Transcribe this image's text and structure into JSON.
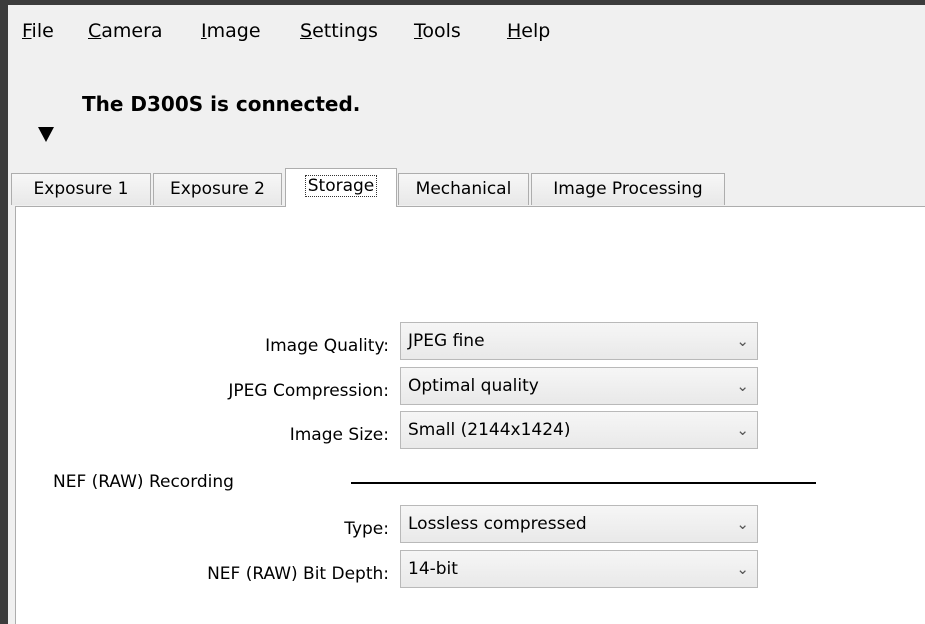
{
  "menu": {
    "file": {
      "mnemonic": "F",
      "rest": "ile"
    },
    "camera": {
      "mnemonic": "C",
      "rest": "amera"
    },
    "image": {
      "mnemonic": "I",
      "rest": "mage"
    },
    "settings": {
      "mnemonic": "S",
      "rest": "ettings"
    },
    "tools": {
      "mnemonic": "T",
      "rest": "ools"
    },
    "help": {
      "mnemonic": "H",
      "rest": "elp"
    }
  },
  "status_text": "The D300S is connected.",
  "tabs": [
    {
      "label": "Exposure 1"
    },
    {
      "label": "Exposure 2"
    },
    {
      "label": "Storage"
    },
    {
      "label": "Mechanical"
    },
    {
      "label": "Image Processing"
    }
  ],
  "active_tab": "Storage",
  "storage": {
    "image_quality": {
      "label": "Image Quality:",
      "value": "JPEG fine"
    },
    "jpeg_compression": {
      "label": "JPEG Compression:",
      "value": "Optimal quality"
    },
    "image_size": {
      "label": "Image Size:",
      "value": "Small (2144x1424)"
    },
    "nef_section": "NEF (RAW) Recording",
    "nef_type": {
      "label": "Type:",
      "value": "Lossless compressed"
    },
    "nef_bit_depth": {
      "label": "NEF (RAW) Bit Depth:",
      "value": "14-bit"
    }
  },
  "icons": {
    "collapse": "triangle-down-icon",
    "dropdown": "chevron-down-icon"
  }
}
